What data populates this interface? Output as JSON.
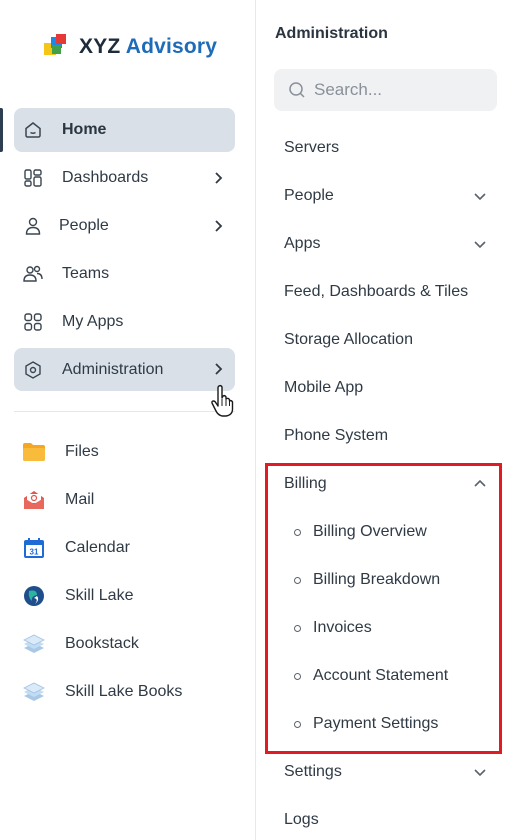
{
  "brand": {
    "name_part1": "XYZ",
    "name_part2": "Advisory"
  },
  "left_nav": {
    "items": [
      {
        "label": "Home",
        "icon": "home-icon",
        "active": true
      },
      {
        "label": "Dashboards",
        "icon": "dashboards-icon",
        "has_chevron": true
      },
      {
        "label": "People",
        "icon": "person-icon",
        "has_chevron": true
      },
      {
        "label": "Teams",
        "icon": "teams-icon"
      },
      {
        "label": "My Apps",
        "icon": "apps-grid-icon"
      },
      {
        "label": "Administration",
        "icon": "admin-hexagon-icon",
        "has_chevron": true,
        "hovered": true
      }
    ],
    "apps": [
      {
        "label": "Files",
        "icon": "folder-icon"
      },
      {
        "label": "Mail",
        "icon": "mail-icon"
      },
      {
        "label": "Calendar",
        "icon": "calendar-icon",
        "badge": "31"
      },
      {
        "label": "Skill Lake",
        "icon": "skill-lake-icon"
      },
      {
        "label": "Bookstack",
        "icon": "bookstack-icon"
      },
      {
        "label": "Skill Lake Books",
        "icon": "bookstack-icon"
      }
    ]
  },
  "admin_panel": {
    "title": "Administration",
    "search_placeholder": "Search...",
    "items": [
      {
        "label": "Servers"
      },
      {
        "label": "People",
        "chevron": "down"
      },
      {
        "label": "Apps",
        "chevron": "down"
      },
      {
        "label": "Feed, Dashboards & Tiles"
      },
      {
        "label": "Storage Allocation"
      },
      {
        "label": "Mobile App"
      },
      {
        "label": "Phone System"
      },
      {
        "label": "Billing",
        "chevron": "up",
        "expanded": true
      }
    ],
    "billing_subitems": [
      {
        "label": "Billing Overview"
      },
      {
        "label": "Billing Breakdown"
      },
      {
        "label": "Invoices"
      },
      {
        "label": "Account Statement"
      },
      {
        "label": "Payment Settings"
      }
    ],
    "after_items": [
      {
        "label": "Settings",
        "chevron": "down"
      },
      {
        "label": "Logs"
      }
    ]
  },
  "colors": {
    "accent": "#1e6bb8",
    "highlight": "#e01b24",
    "active_bg": "#d9e0e8"
  }
}
